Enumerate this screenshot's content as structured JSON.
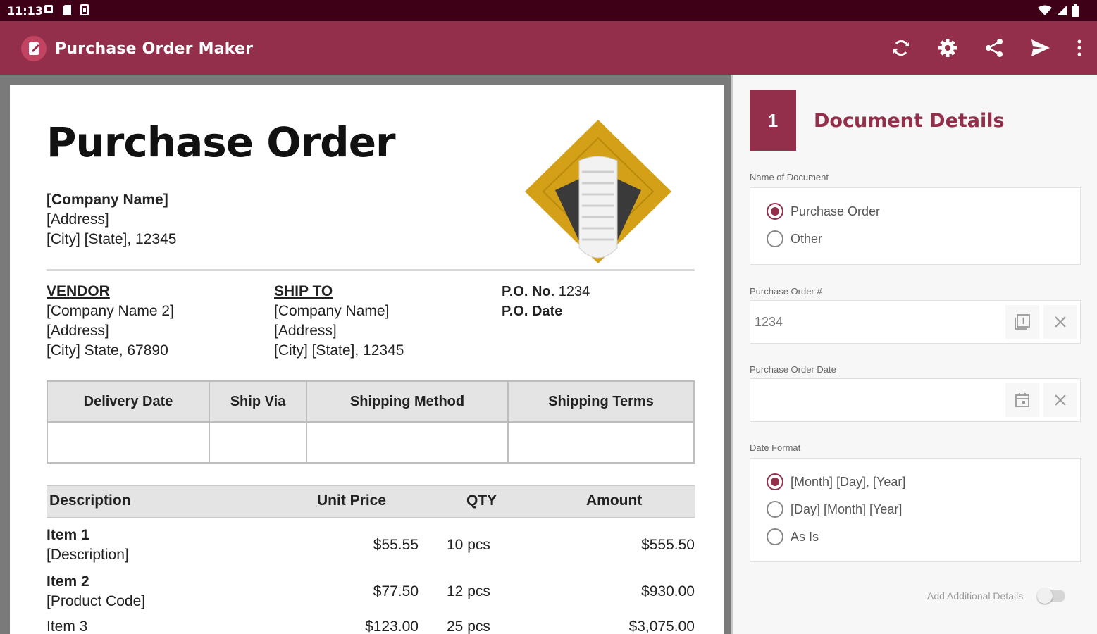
{
  "status": {
    "time": "11:13",
    "icons": [
      "notification-icon",
      "sd-card-icon",
      "sim-icon"
    ],
    "right_icons": [
      "wifi-icon",
      "signal-icon",
      "battery-icon"
    ]
  },
  "appbar": {
    "title": "Purchase Order Maker",
    "actions": [
      "refresh-icon",
      "settings-icon",
      "share-icon",
      "send-icon",
      "more-icon"
    ]
  },
  "document": {
    "title": "Purchase Order",
    "company": {
      "name": "[Company Name]",
      "address": "[Address]",
      "city": "[City] [State], 12345"
    },
    "vendor": {
      "heading": "VENDOR",
      "name": "[Company Name 2]",
      "address": "[Address]",
      "city": "[City] State, 67890"
    },
    "ship_to": {
      "heading": "SHIP TO",
      "name": "[Company Name]",
      "address": "[Address]",
      "city": "[City] [State], 12345"
    },
    "po_no_label": "P.O. No.",
    "po_no_value": "1234",
    "po_date_label": "P.O. Date",
    "shipping_headers": [
      "Delivery Date",
      "Ship Via",
      "Shipping Method",
      "Shipping Terms"
    ],
    "items_headers": {
      "description": "Description",
      "unit_price": "Unit Price",
      "qty": "QTY",
      "amount": "Amount"
    },
    "items": [
      {
        "name": "Item 1",
        "sub": "[Description]",
        "unit_price": "$55.55",
        "qty": "10 pcs",
        "amount": "$555.50"
      },
      {
        "name": "Item 2",
        "sub": "[Product Code]",
        "unit_price": "$77.50",
        "qty": "12 pcs",
        "amount": "$930.00"
      },
      {
        "name": "Item 3",
        "sub": "",
        "unit_price": "$123.00",
        "qty": "25 pcs",
        "amount": "$3,075.00"
      }
    ]
  },
  "panel": {
    "step_number": "1",
    "step_title": "Document Details",
    "name_label": "Name of Document",
    "name_options": [
      "Purchase Order",
      "Other"
    ],
    "po_number_label": "Purchase Order #",
    "po_number_value": "1234",
    "po_date_label": "Purchase Order Date",
    "po_date_value": "",
    "date_format_label": "Date Format",
    "date_format_options": [
      "[Month] [Day], [Year]",
      "[Day] [Month] [Year]",
      "As Is"
    ],
    "additional_label": "Add Additional Details"
  },
  "colors": {
    "primary": "#932f4a",
    "status_bar": "#3e0016",
    "logo_gold": "#d4a017"
  }
}
